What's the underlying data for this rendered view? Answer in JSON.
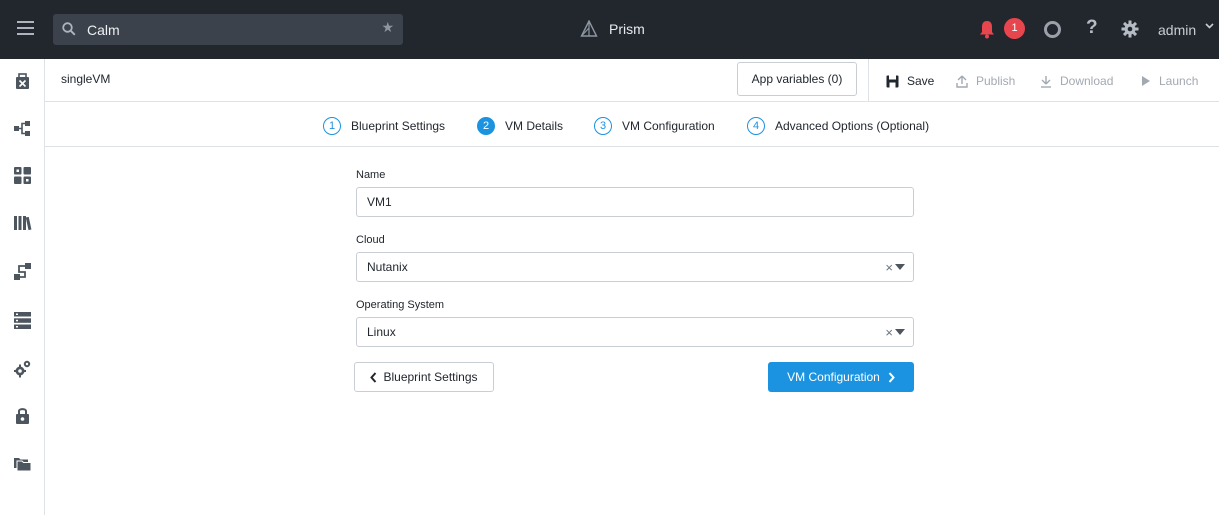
{
  "topbar": {
    "search_value": "Calm",
    "app_name": "Prism",
    "alert_count": "1",
    "help_glyph": "?",
    "user": "admin",
    "icons": [
      "menu-icon",
      "search-icon",
      "star-icon",
      "prism-logo-icon",
      "bell-icon",
      "task-ring-icon",
      "help-icon",
      "gear-icon",
      "chevron-down-icon"
    ]
  },
  "leftnav": {
    "icons": [
      "blueprint-icon",
      "topology-icon",
      "apps-grid-icon",
      "library-icon",
      "runbook-icon",
      "marketplace-list-icon",
      "settings-cogs-icon",
      "secure-lock-icon",
      "folders-icon"
    ]
  },
  "header": {
    "blueprint_name": "singleVM",
    "app_variables": "App variables (0)",
    "save": "Save",
    "publish": "Publish",
    "download": "Download",
    "launch": "Launch"
  },
  "steps": [
    {
      "num": "1",
      "label": "Blueprint Settings",
      "active": false
    },
    {
      "num": "2",
      "label": "VM Details",
      "active": true
    },
    {
      "num": "3",
      "label": "VM Configuration",
      "active": false
    },
    {
      "num": "4",
      "label": "Advanced Options (Optional)",
      "active": false
    }
  ],
  "form": {
    "name_label": "Name",
    "name_value": "VM1",
    "cloud_label": "Cloud",
    "cloud_value": "Nutanix",
    "os_label": "Operating System",
    "os_value": "Linux",
    "clear_glyph": "×"
  },
  "buttons": {
    "back": "Blueprint Settings",
    "next": "VM Configuration"
  },
  "colors": {
    "topbar": "#22272e",
    "accent": "#1b93e0",
    "alert": "#e8464e"
  }
}
